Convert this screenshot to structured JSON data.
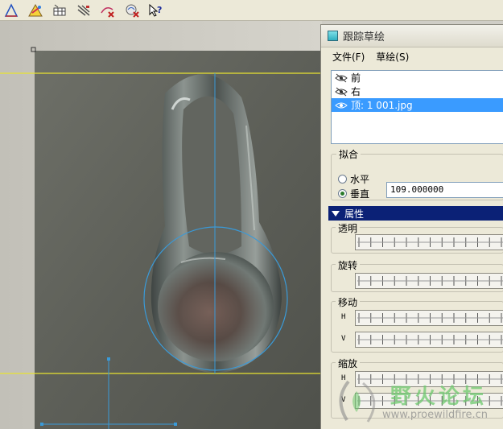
{
  "toolbar": {
    "buttons": [
      {
        "icon": "sketch-triangle-icon"
      },
      {
        "icon": "color-palette-icon"
      },
      {
        "icon": "ruler-grid-icon"
      },
      {
        "icon": "hatch-tool-icon"
      },
      {
        "icon": "erase-curve-icon"
      },
      {
        "icon": "delete-sketch-icon"
      },
      {
        "icon": "context-help-icon"
      }
    ]
  },
  "colors": {
    "guide_line": "#e8e230",
    "sketch_line": "#3a9ad8",
    "selection": "#3a9bff",
    "props_header": "#0b2176"
  },
  "dialog": {
    "title": "跟踪草绘",
    "menu": [
      "文件(F)",
      "草绘(S)"
    ],
    "images": [
      {
        "label": "前",
        "visible": false
      },
      {
        "label": "右",
        "visible": false
      },
      {
        "label": "顶: 1 001.jpg",
        "visible": true,
        "selected": true
      }
    ],
    "fit": {
      "legend": "拟合",
      "horizontal_label": "水平",
      "vertical_label": "垂直",
      "selected": "vertical",
      "value": "109.000000"
    },
    "properties": {
      "header": "属性",
      "transparency_label": "透明",
      "rotation_label": "旋转",
      "move_label": "移动",
      "move_h": "H",
      "move_v": "V",
      "scale_label": "缩放",
      "scale_h": "H",
      "scale_v": "V"
    }
  },
  "watermark": {
    "text": "野火论坛",
    "url": "www.proewildfire.cn"
  }
}
